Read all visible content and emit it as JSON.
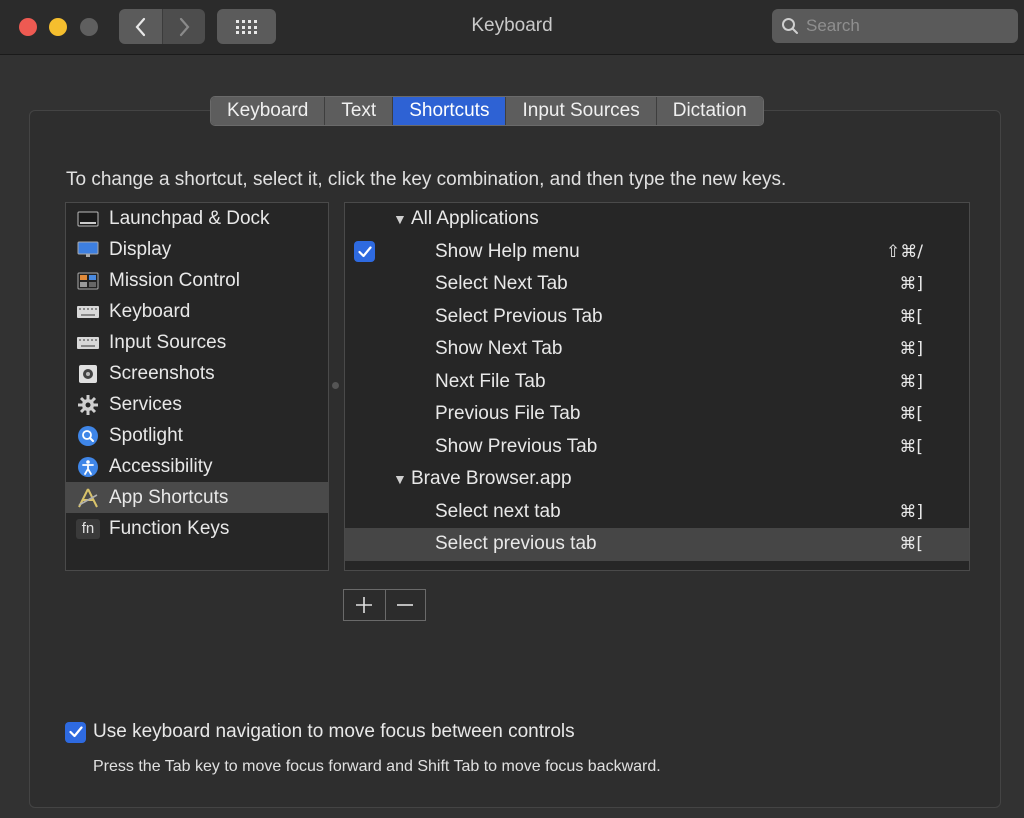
{
  "window": {
    "title": "Keyboard"
  },
  "search": {
    "placeholder": "Search"
  },
  "tabs": [
    {
      "label": "Keyboard"
    },
    {
      "label": "Text"
    },
    {
      "label": "Shortcuts"
    },
    {
      "label": "Input Sources"
    },
    {
      "label": "Dictation"
    }
  ],
  "instructions": "To change a shortcut, select it, click the key combination, and then type the new keys.",
  "categories": [
    {
      "label": "Launchpad & Dock",
      "icon": "launchpad-icon"
    },
    {
      "label": "Display",
      "icon": "display-icon"
    },
    {
      "label": "Mission Control",
      "icon": "mission-control-icon"
    },
    {
      "label": "Keyboard",
      "icon": "keyboard-icon"
    },
    {
      "label": "Input Sources",
      "icon": "input-sources-icon"
    },
    {
      "label": "Screenshots",
      "icon": "screenshots-icon"
    },
    {
      "label": "Services",
      "icon": "gear-icon"
    },
    {
      "label": "Spotlight",
      "icon": "spotlight-icon"
    },
    {
      "label": "Accessibility",
      "icon": "accessibility-icon"
    },
    {
      "label": "App Shortcuts",
      "icon": "app-shortcuts-icon",
      "selected": true
    },
    {
      "label": "Function Keys",
      "icon": "fn-icon",
      "icon_text": "fn"
    }
  ],
  "shortcuts": {
    "groups": [
      {
        "label": "All Applications",
        "items": [
          {
            "label": "Show Help menu",
            "keys": "⇧⌘/",
            "checked": true
          },
          {
            "label": "Select Next Tab",
            "keys": "⌘]"
          },
          {
            "label": "Select Previous Tab",
            "keys": "⌘["
          },
          {
            "label": "Show Next Tab",
            "keys": "⌘]"
          },
          {
            "label": "Next File Tab",
            "keys": "⌘]"
          },
          {
            "label": "Previous File Tab",
            "keys": "⌘["
          },
          {
            "label": "Show Previous Tab",
            "keys": "⌘["
          }
        ]
      },
      {
        "label": "Brave Browser.app",
        "items": [
          {
            "label": "Select next tab",
            "keys": "⌘]"
          },
          {
            "label": "Select previous tab",
            "keys": "⌘[",
            "selected": true
          }
        ]
      }
    ]
  },
  "keyboard_navigation": {
    "label": "Use keyboard navigation to move focus between controls",
    "checked": true,
    "hint": "Press the Tab key to move focus forward and Shift Tab to move focus backward."
  },
  "colors": {
    "accent": "#2e62d4",
    "background": "#323232"
  }
}
